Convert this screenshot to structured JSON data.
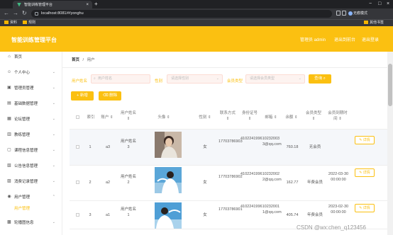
{
  "browser": {
    "tab_title": "智能训练管理平台",
    "url": "localhost:8081/#/yonghu",
    "profile_label": "无痕模式",
    "bookmarks": [
      "资料",
      "规则"
    ],
    "other_bookmarks": "其他书签"
  },
  "header": {
    "brand": "智能训练管理平台",
    "user_label": "管理员 admin",
    "exit_front": "退出到前台",
    "logout": "退出登录",
    "color": "#fbc011"
  },
  "sidebar": {
    "items": [
      {
        "label": "首页",
        "icon": "home-icon"
      },
      {
        "label": "个人中心",
        "icon": "user-icon"
      },
      {
        "label": "管理员管理",
        "icon": "admin-icon"
      },
      {
        "label": "基础数据管理",
        "icon": "data-icon"
      },
      {
        "label": "论坛管理",
        "icon": "forum-icon"
      },
      {
        "label": "教练管理",
        "icon": "coach-icon"
      },
      {
        "label": "课程信息管理",
        "icon": "course-icon"
      },
      {
        "label": "公告信息管理",
        "icon": "notice-icon"
      },
      {
        "label": "消费记录管理",
        "icon": "record-icon"
      },
      {
        "label": "用户管理",
        "icon": "location-icon"
      },
      {
        "label": "用户管理",
        "icon": ""
      },
      {
        "label": "轮播图信息",
        "icon": "image-icon"
      }
    ]
  },
  "breadcrumb": {
    "home": "首页",
    "sep": "/",
    "current": "用户"
  },
  "filters": {
    "name_label": "用户姓名",
    "name_placeholder": "用户姓名",
    "gender_label": "性别",
    "gender_placeholder": "请选择性别",
    "member_label": "会员类型",
    "member_placeholder": "请选择会员类型",
    "query_button": "查询"
  },
  "actions": {
    "add": "新增",
    "delete": "删除"
  },
  "table": {
    "headers": [
      "索引",
      "账户",
      "用户姓名",
      "头像",
      "性别",
      "联系方式",
      "身份证号",
      "邮箱",
      "余额",
      "会员类型",
      "会员到期时间"
    ],
    "detail_label": "详情",
    "rows": [
      {
        "index": "1",
        "account": "a3",
        "name": "用户姓名3",
        "gender": "女",
        "phone": "17703786903",
        "idcard": "410224199610232003",
        "email": "3@qq.com",
        "balance": "760.18",
        "member": "无会员",
        "expire": ""
      },
      {
        "index": "2",
        "account": "a2",
        "name": "用户姓名2",
        "gender": "女",
        "phone": "17703786902",
        "idcard": "410224199610232002",
        "email": "2@qq.com",
        "balance": "162.77",
        "member": "年费会员",
        "expire": "2022-03-30 00:00:00"
      },
      {
        "index": "3",
        "account": "a1",
        "name": "用户姓名1",
        "gender": "女",
        "phone": "17703786901",
        "idcard": "410224199610232001",
        "email": "1@qq.com",
        "balance": "405.74",
        "member": "年费会员",
        "expire": "2023-02-30 00:00:00"
      }
    ]
  },
  "watermark": "CSDN @wx:chen_q123456"
}
